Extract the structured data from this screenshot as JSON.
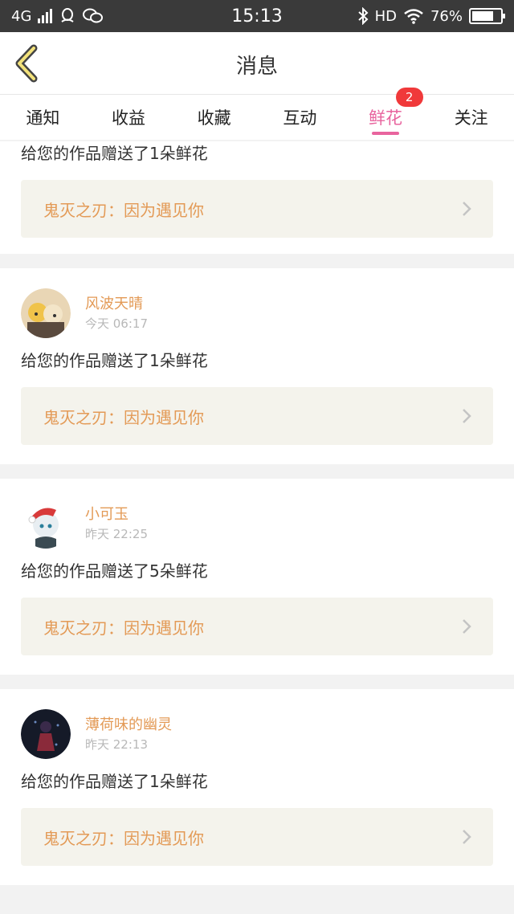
{
  "status_bar": {
    "network": "4G",
    "time": "15:13",
    "hd_label": "HD",
    "battery": "76%",
    "battery_level": 0.76
  },
  "header": {
    "title": "消息"
  },
  "tabs": [
    {
      "label": "通知",
      "active": false
    },
    {
      "label": "收益",
      "active": false
    },
    {
      "label": "收藏",
      "active": false
    },
    {
      "label": "互动",
      "active": false
    },
    {
      "label": "鲜花",
      "active": true,
      "badge": "2"
    },
    {
      "label": "关注",
      "active": false
    }
  ],
  "colors": {
    "accent": "#e8649e",
    "badge": "#f0393a",
    "username": "#e39a56",
    "work_box_bg": "#f4f3ec"
  },
  "messages": [
    {
      "message": "给您的作品赠送了1朵鲜花",
      "work_title": "鬼灭之刃：因为遇见你"
    },
    {
      "username": "风波天晴",
      "time": "今天 06:17",
      "message": "给您的作品赠送了1朵鲜花",
      "work_title": "鬼灭之刃：因为遇见你"
    },
    {
      "username": "小可玉",
      "time": "昨天 22:25",
      "message": "给您的作品赠送了5朵鲜花",
      "work_title": "鬼灭之刃：因为遇见你"
    },
    {
      "username": "薄荷味的幽灵",
      "time": "昨天 22:13",
      "message": "给您的作品赠送了1朵鲜花",
      "work_title": "鬼灭之刃：因为遇见你"
    }
  ]
}
